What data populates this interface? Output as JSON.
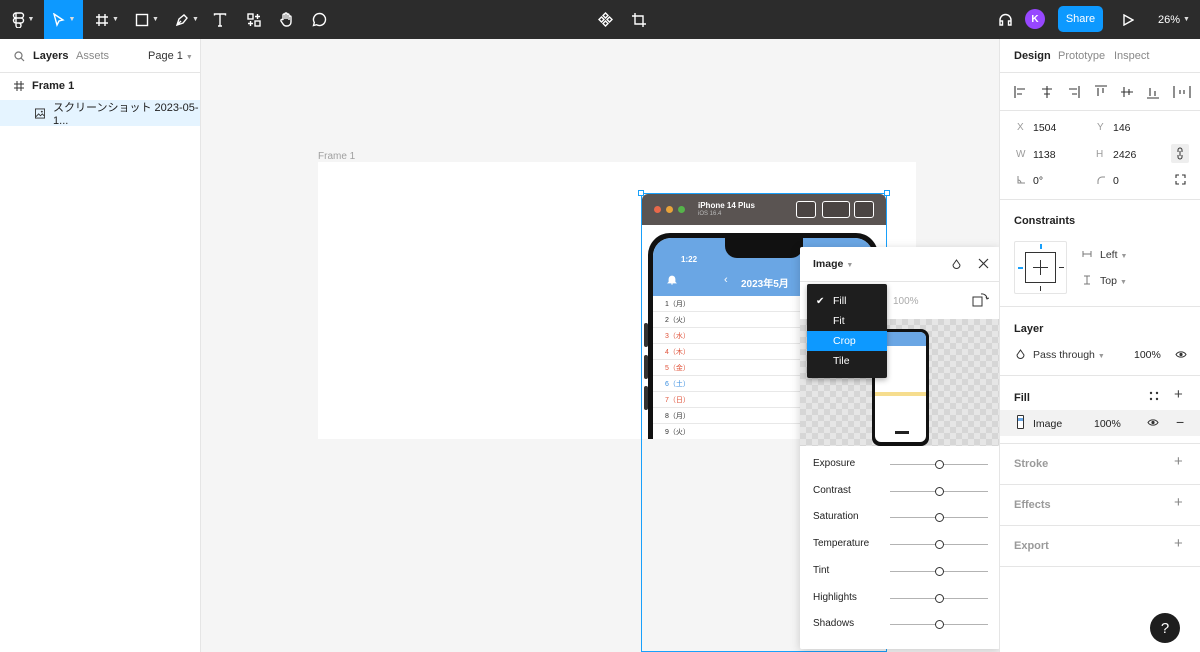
{
  "toolbar": {
    "share_label": "Share",
    "avatar_initial": "K",
    "zoom": "26%"
  },
  "left_panel": {
    "tabs": [
      "Layers",
      "Assets"
    ],
    "page": "Page 1",
    "layers": [
      {
        "name": "Frame 1",
        "type": "frame"
      },
      {
        "name": "スクリーンショット 2023-05-1...",
        "type": "image"
      }
    ]
  },
  "canvas": {
    "frame_label": "Frame 1",
    "simulator_title": "iPhone 14 Plus",
    "simulator_subtitle": "iOS 16.4",
    "status_time": "1:22",
    "nav_month": "2023年5月",
    "days": [
      {
        "label": "1（月）",
        "color": "#333333"
      },
      {
        "label": "2（火）",
        "color": "#333333"
      },
      {
        "label": "3（水）",
        "color": "#e0533a"
      },
      {
        "label": "4（木）",
        "color": "#e0533a"
      },
      {
        "label": "5（金）",
        "color": "#e0533a"
      },
      {
        "label": "6（土）",
        "color": "#3a8ee0"
      },
      {
        "label": "7（日）",
        "color": "#e0533a"
      },
      {
        "label": "8（月）",
        "color": "#333333"
      },
      {
        "label": "9（火）",
        "color": "#333333"
      }
    ]
  },
  "image_popup": {
    "title": "Image",
    "opacity": "100%",
    "fill_options": [
      "Fill",
      "Fit",
      "Crop",
      "Tile"
    ],
    "checked_option": "Fill",
    "highlighted_option": "Crop",
    "adjustments": [
      "Exposure",
      "Contrast",
      "Saturation",
      "Temperature",
      "Tint",
      "Highlights",
      "Shadows"
    ]
  },
  "right_panel": {
    "tabs": [
      "Design",
      "Prototype",
      "Inspect"
    ],
    "x_label": "X",
    "x": "1504",
    "y_label": "Y",
    "y": "146",
    "w_label": "W",
    "w": "1138",
    "h_label": "H",
    "h": "2426",
    "rotation": "0°",
    "radius": "0",
    "constraints_title": "Constraints",
    "constraint_h": "Left",
    "constraint_v": "Top",
    "layer_title": "Layer",
    "blend_mode": "Pass through",
    "layer_opacity": "100%",
    "fill_title": "Fill",
    "fill_type": "Image",
    "fill_opacity": "100%",
    "stroke_title": "Stroke",
    "effects_title": "Effects",
    "export_title": "Export"
  },
  "help_label": "?"
}
